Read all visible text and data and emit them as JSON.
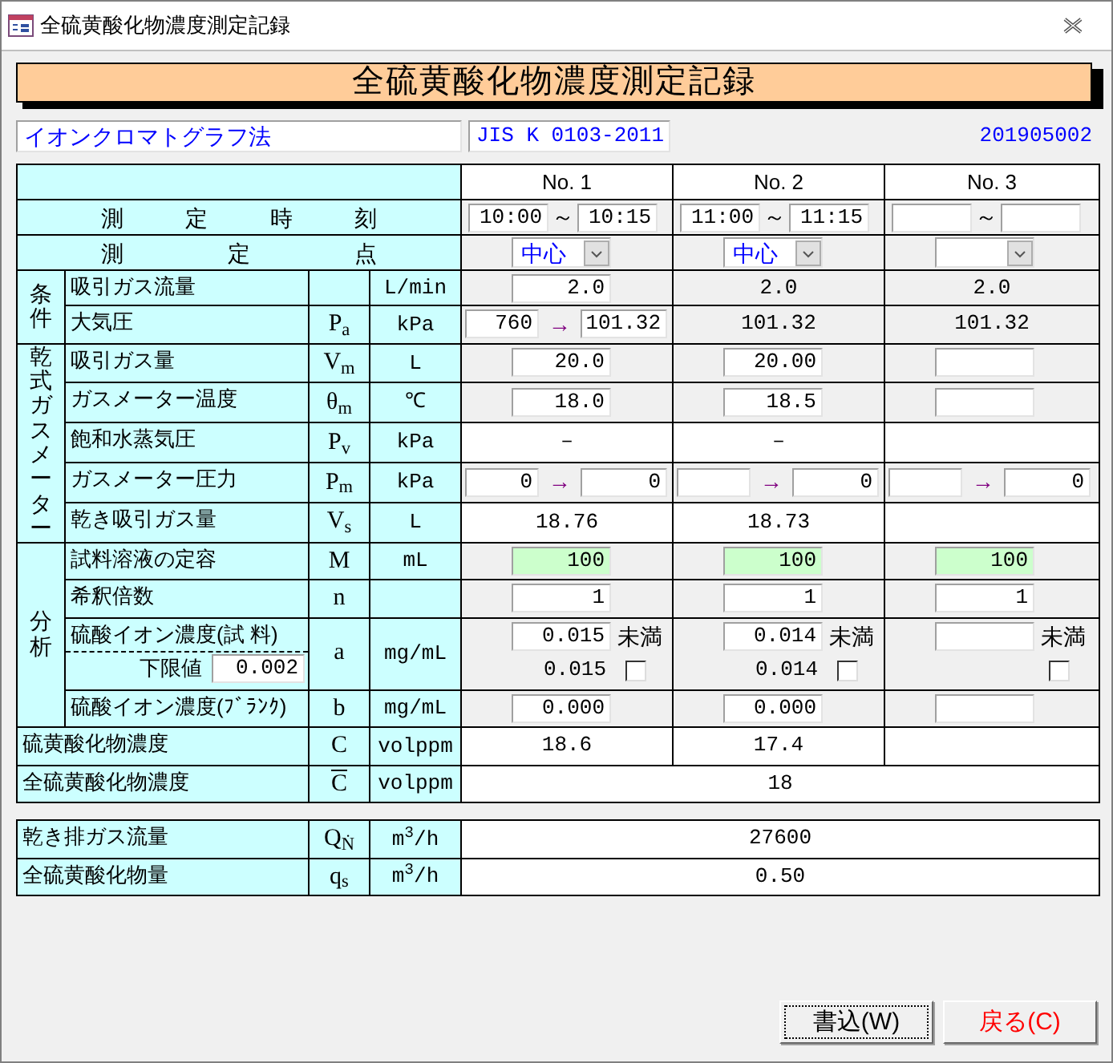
{
  "window": {
    "title": "全硫黄酸化物濃度測定記録"
  },
  "heading": "全硫黄酸化物濃度測定記録",
  "method_field": {
    "value": "イオンクロマトグラフ法"
  },
  "standard_field": {
    "value": "JIS K 0103-2011"
  },
  "record_number": "201905002",
  "columns": [
    "No. 1",
    "No. 2",
    "No. 3"
  ],
  "sections": [
    {
      "kind": "wide",
      "rows": [
        {
          "label": "測定時刻",
          "cells": [
            {
              "kind": "time",
              "from": "10:00",
              "sep": "～",
              "to": "10:15"
            },
            {
              "kind": "time",
              "from": "11:00",
              "sep": "～",
              "to": "11:15"
            },
            {
              "kind": "time",
              "sep": "～"
            }
          ]
        },
        {
          "label": "測定点",
          "cells": [
            {
              "kind": "combo",
              "value": "中心"
            },
            {
              "kind": "combo",
              "value": "中心"
            },
            {
              "kind": "combo"
            }
          ]
        }
      ]
    },
    {
      "kind": "group",
      "group": "条件",
      "rows": [
        {
          "label": "吸引ガス流量",
          "unit": "L/min",
          "cells": [
            {
              "kind": "input",
              "value": "2.0",
              "highlight": false
            },
            {
              "kind": "text",
              "text": "2.0"
            },
            {
              "kind": "text",
              "text": "2.0"
            }
          ]
        },
        {
          "label": "大気圧",
          "symbol": "P$_{a}$",
          "unit": "kPa",
          "cells": [
            {
              "kind": "pair",
              "from": "760",
              "arrow": "→",
              "to": "101.32"
            },
            {
              "kind": "text",
              "text": "101.32"
            },
            {
              "kind": "text",
              "text": "101.32"
            }
          ]
        }
      ]
    },
    {
      "kind": "group",
      "group": "乾式ガスメーター",
      "rows": [
        {
          "label": "吸引ガス量",
          "symbol": "V$_{m}$",
          "unit": "L",
          "cells": [
            {
              "kind": "input",
              "value": "20.0",
              "highlight": false
            },
            {
              "kind": "input",
              "value": "20.00",
              "highlight": false
            },
            {
              "kind": "input",
              "highlight": false
            }
          ]
        },
        {
          "label": "ガスメーター温度",
          "symbol": "θ$_{m}$",
          "unit": "℃",
          "cells": [
            {
              "kind": "input",
              "value": "18.0",
              "highlight": false
            },
            {
              "kind": "input",
              "value": "18.5",
              "highlight": false
            },
            {
              "kind": "input",
              "highlight": false
            }
          ]
        },
        {
          "label": "飽和水蒸気圧",
          "symbol": "P$_{v}$",
          "unit": "kPa",
          "cells": [
            {
              "kind": "text",
              "text": "－"
            },
            {
              "kind": "text",
              "text": "－"
            },
            {
              "kind": "empty"
            }
          ]
        },
        {
          "label": "ガスメーター圧力",
          "symbol": "P$_{m}$",
          "unit": "kPa",
          "cells": [
            {
              "kind": "pair",
              "from": "0",
              "arrow": "→",
              "to": "0"
            },
            {
              "kind": "pair",
              "arrow": "→",
              "to": "0"
            },
            {
              "kind": "pair",
              "arrow": "→",
              "to": "0"
            }
          ]
        },
        {
          "label": "乾き吸引ガス量",
          "symbol": "V$_{s}$",
          "unit": "L",
          "cells": [
            {
              "kind": "text",
              "text": "18.76"
            },
            {
              "kind": "text",
              "text": "18.73"
            },
            {
              "kind": "empty"
            }
          ]
        }
      ]
    },
    {
      "kind": "group",
      "group": "分析",
      "rows": [
        {
          "label": "試料溶液の定容",
          "symbol": "M",
          "unit": "mL",
          "cells": [
            {
              "kind": "input",
              "value": "100",
              "highlight": true
            },
            {
              "kind": "input",
              "value": "100",
              "highlight": true
            },
            {
              "kind": "input",
              "value": "100",
              "highlight": true
            }
          ]
        },
        {
          "label": "希釈倍数",
          "symbol": "n",
          "cells": [
            {
              "kind": "input",
              "value": "1",
              "highlight": false
            },
            {
              "kind": "input",
              "value": "1",
              "highlight": false
            },
            {
              "kind": "input",
              "value": "1",
              "highlight": false
            }
          ]
        },
        {
          "label": "硫酸イオン濃度(試 料)",
          "sublabel": "下限値",
          "subvalue": "0.002",
          "symbol": "a",
          "unit": "mg/mL",
          "cells": [
            {
              "kind": "limit",
              "value": "0.015",
              "suffix": "未満",
              "result": "0.015",
              "checked": false
            },
            {
              "kind": "limit",
              "value": "0.014",
              "suffix": "未満",
              "result": "0.014",
              "checked": false
            },
            {
              "kind": "limit",
              "suffix": "未満",
              "checked": false
            }
          ]
        },
        {
          "label": "硫酸イオン濃度(ﾌﾞﾗﾝｸ)",
          "symbol": "b",
          "unit": "mg/mL",
          "cells": [
            {
              "kind": "input",
              "value": "0.000",
              "highlight": false
            },
            {
              "kind": "input",
              "value": "0.000",
              "highlight": false
            },
            {
              "kind": "input",
              "highlight": false
            }
          ]
        }
      ]
    },
    {
      "kind": "plain",
      "rows": [
        {
          "label": "硫黄酸化物濃度",
          "symbol": "C",
          "overline": false,
          "unit": "volppm",
          "cells": [
            {
              "kind": "text",
              "text": "18.6"
            },
            {
              "kind": "text",
              "text": "17.4"
            },
            {
              "kind": "empty"
            }
          ]
        },
        {
          "label": "全硫黄酸化物濃度",
          "symbol": "C",
          "overline": true,
          "unit": "volppm",
          "value": "18"
        }
      ]
    }
  ],
  "totals": [
    {
      "label": "乾き排ガス流量",
      "symbol": "Q$_{Ṅ}$",
      "unit": "m$^{3}$/h",
      "value": "27600"
    },
    {
      "label": "全硫黄酸化物量",
      "symbol": "q$_{s}$",
      "unit": "m$^{3}$/h",
      "value": "0.50"
    }
  ],
  "buttons": [
    {
      "label": "書込(W)",
      "kind": "save",
      "focused": true
    },
    {
      "label": "戻る(C)",
      "kind": "back",
      "focused": false
    }
  ]
}
